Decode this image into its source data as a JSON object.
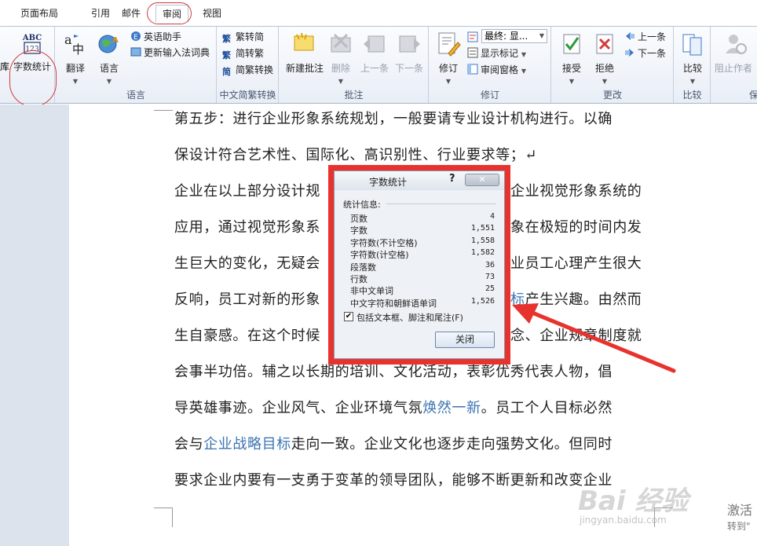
{
  "tabs": [
    {
      "label": "页面布局"
    },
    {
      "label": "引用"
    },
    {
      "label": "邮件"
    },
    {
      "label": "审阅",
      "active": true
    },
    {
      "label": "视图"
    }
  ],
  "ribbon": {
    "cut_left_label": "库",
    "word_count": {
      "icon_text_top": "ABC",
      "icon_text_bottom": "123",
      "label": "字数统计"
    },
    "language_group": {
      "translate": "翻译",
      "language": "语言",
      "english_assistant": "英语助手",
      "update_ime": "更新输入法词典",
      "group_label": "语言"
    },
    "chinese_convert_group": {
      "to_traditional": "繁转简",
      "to_simplified": "简转繁",
      "convert": "简繁转换",
      "group_label": "中文简繁转换"
    },
    "comments_group": {
      "new_comment": "新建批注",
      "delete": "删除",
      "previous": "上一条",
      "next": "下一条",
      "group_label": "批注"
    },
    "tracking_group": {
      "track_changes": "修订",
      "display_combo": "最终: 显...",
      "show_markup": "显示标记",
      "reviewing_pane": "审阅窗格",
      "group_label": "修订"
    },
    "changes_group": {
      "accept": "接受",
      "reject": "拒绝",
      "previous": "上一条",
      "next": "下一条",
      "group_label": "更改"
    },
    "compare_group": {
      "compare": "比较",
      "group_label": "比较"
    },
    "protect_group": {
      "block_authors": "阻止作者",
      "group_label": "保"
    }
  },
  "document": {
    "lines": [
      [
        {
          "t": "第五步：进行企业形象系统规划，一般要请专业设计机构进行。以确"
        }
      ],
      [
        {
          "t": "保设计符合艺术性、国际化、高识别性、行业要求等；↵"
        }
      ],
      [
        {
          "t": "企业在以上部分设计规"
        },
        {
          "t": "企业视觉形象系统的",
          "gap": true
        }
      ],
      [
        {
          "t": "应用，通过视觉形象系"
        },
        {
          "t": "象在极短的时间内发",
          "gap": true
        }
      ],
      [
        {
          "t": "生巨大的变化，无疑会"
        },
        {
          "t": "业员工心理产生很大",
          "gap": true
        }
      ],
      [
        {
          "t": "反响，员工对新的形象"
        },
        {
          "t": "标",
          "link": true,
          "gap": true
        },
        {
          "t": "产生兴趣。由然而"
        }
      ],
      [
        {
          "t": "生自豪感。在这个时候"
        },
        {
          "t": "念、企业规章制度就",
          "gap": true
        }
      ],
      [
        {
          "t": "会事半功倍。辅之以长期的培训、文化活动，表彰优秀代表人物，倡"
        }
      ],
      [
        {
          "t": "导英雄事迹。企业风气、企业环境气氛"
        },
        {
          "t": "焕然一新",
          "link": true
        },
        {
          "t": "。员工个人目标必然"
        }
      ],
      [
        {
          "t": "会与"
        },
        {
          "t": "企业战略目标",
          "link": true
        },
        {
          "t": "走向一致。企业文化也逐步走向强势文化。但同时"
        }
      ],
      [
        {
          "t": "要求企业内要有一支勇于变革的领导团队，能够不断更新和改变企业"
        }
      ]
    ]
  },
  "dialog": {
    "title": "字数统计",
    "help": "?",
    "close_x": "✕",
    "section_label": "统计信息:",
    "stats": [
      {
        "label": "页数",
        "value": "4"
      },
      {
        "label": "字数",
        "value": "1,551"
      },
      {
        "label": "字符数(不计空格)",
        "value": "1,558"
      },
      {
        "label": "字符数(计空格)",
        "value": "1,582"
      },
      {
        "label": "段落数",
        "value": "36"
      },
      {
        "label": "行数",
        "value": "73"
      },
      {
        "label": "非中文单词",
        "value": "25"
      },
      {
        "label": "中文字符和朝鲜语单词",
        "value": "1,526"
      }
    ],
    "include_checkbox": {
      "checked": true,
      "label": "包括文本框、脚注和尾注(F)"
    },
    "close_button": "关闭"
  },
  "overlay": {
    "watermark": "Bai 经验",
    "watermark_sub": "jingyan.baidu.com",
    "activate_title": "激活",
    "activate_sub": "转到\""
  },
  "colors": {
    "annotation_red": "#e8322e",
    "link_blue": "#3c74b3",
    "ribbon_bg": "#e9eef6"
  }
}
